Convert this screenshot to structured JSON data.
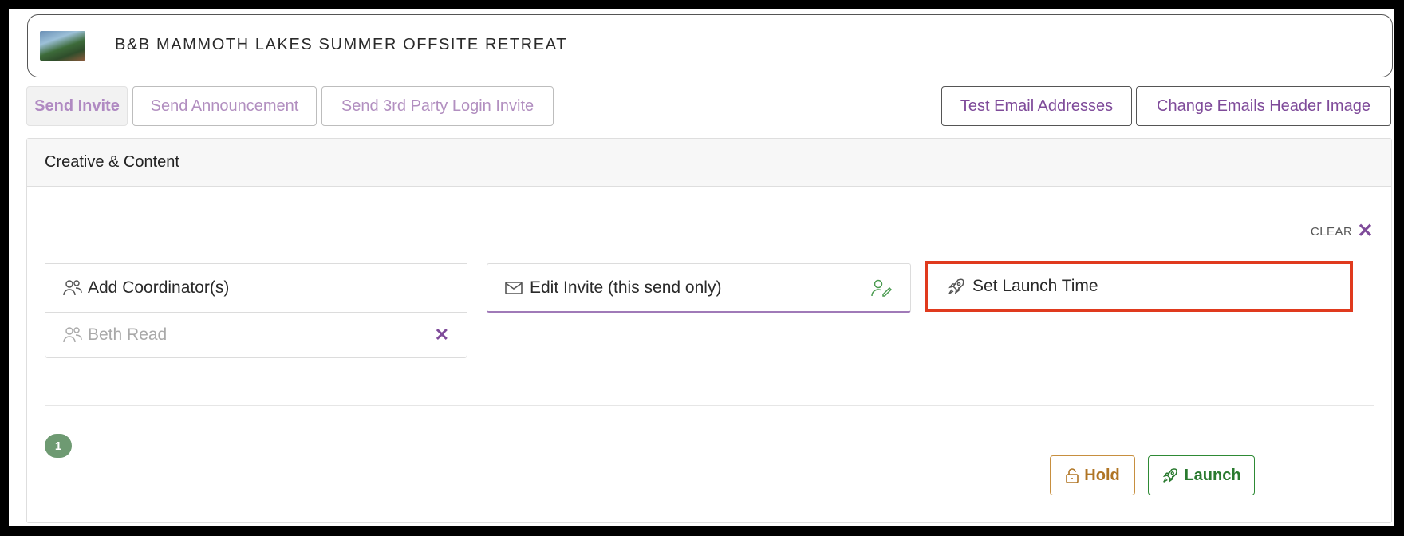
{
  "header": {
    "title": "B&B MAMMOTH LAKES SUMMER OFFSITE RETREAT",
    "logo_icon": "event-thumbnail-image"
  },
  "tabs": [
    {
      "label": "Send Invite",
      "active": true
    },
    {
      "label": "Send Announcement",
      "active": false
    },
    {
      "label": "Send 3rd Party Login Invite",
      "active": false
    }
  ],
  "actions_top": {
    "test_emails": "Test Email Addresses",
    "change_header": "Change Emails Header Image"
  },
  "panel": {
    "title": "Creative & Content",
    "clear_label": "CLEAR",
    "clear_icon": "close-icon",
    "add_coordinators": {
      "label": "Add Coordinator(s)",
      "icon": "users-icon"
    },
    "edit_invite": {
      "label": "Edit Invite (this send only)",
      "icon": "envelope-icon",
      "trailing_icon": "user-edit-icon"
    },
    "set_launch": {
      "label": "Set Launch Time",
      "icon": "rocket-icon"
    },
    "coordinators": [
      {
        "name": "Beth Read",
        "icon": "users-icon",
        "remove_icon": "close-icon"
      }
    ],
    "count_badge": "1",
    "hold_label": "Hold",
    "hold_icon": "lock-icon",
    "launch_label": "Launch",
    "launch_icon": "rocket-icon"
  },
  "colors": {
    "accent_purple": "#7f4b9a",
    "highlight_red": "#e03a1e",
    "success_green": "#2a7a2f",
    "warning_gold": "#b07524",
    "badge_green": "#6e9a72"
  }
}
